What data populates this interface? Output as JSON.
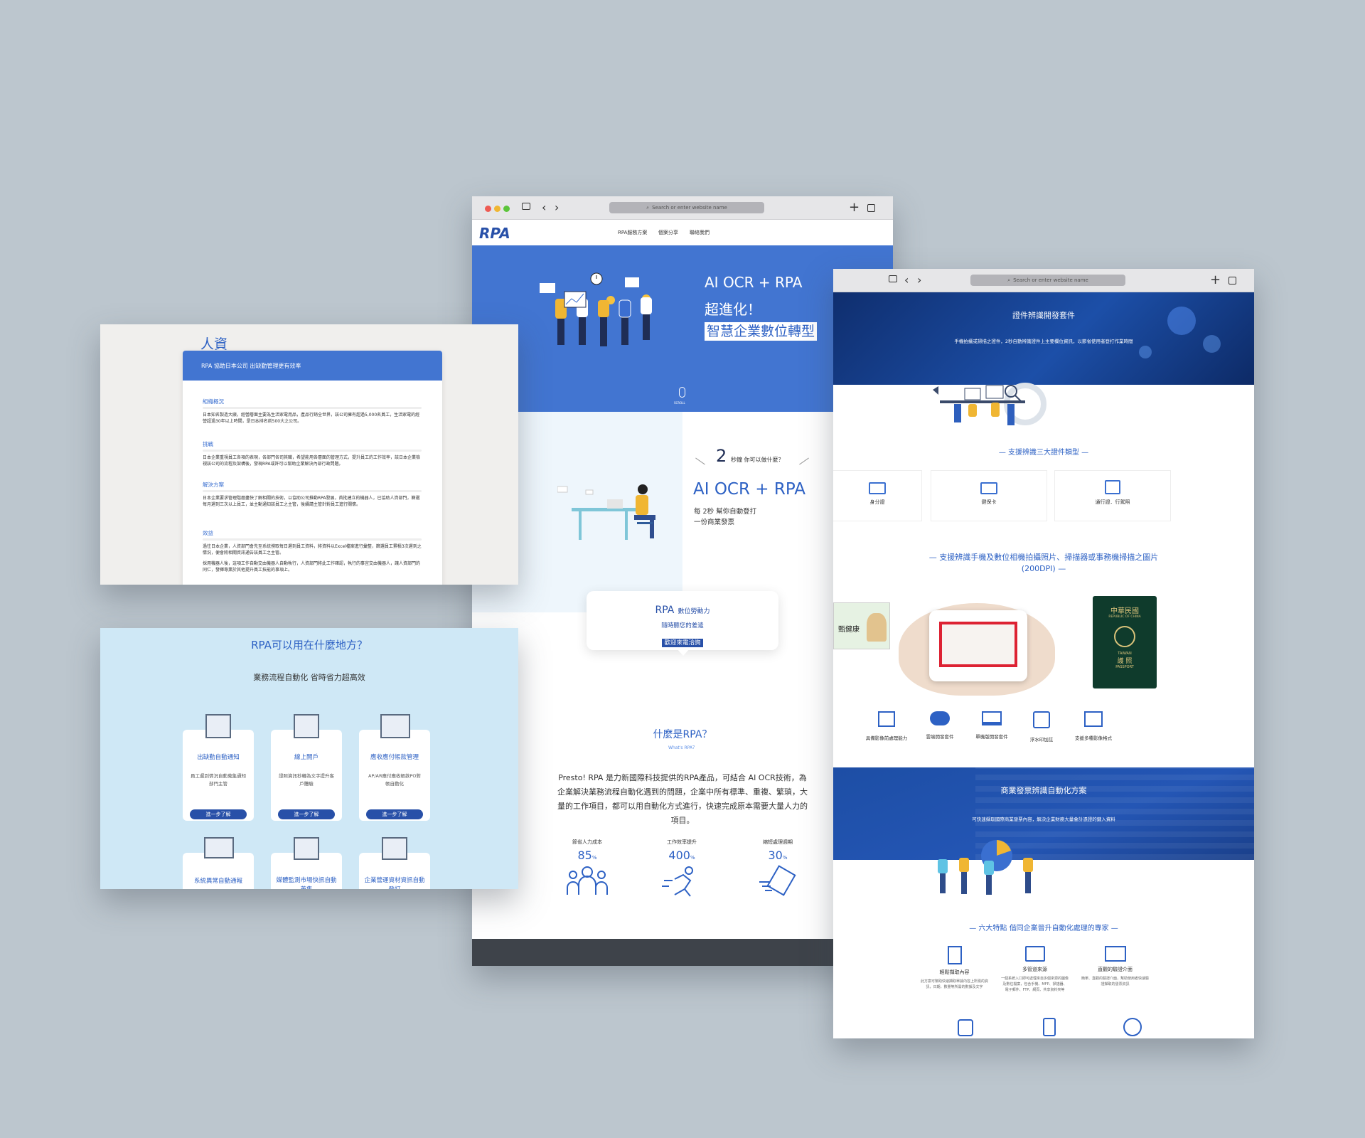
{
  "browser": {
    "url_placeholder": "Search or enter website name",
    "plus": "+",
    "back": "‹",
    "forward": "›"
  },
  "main_site": {
    "logo": "RPA",
    "nav": [
      "RPA服務方案",
      "個案分享",
      "聯絡我們"
    ],
    "hero": {
      "line1": "AI OCR + RPA",
      "line2": "超進化！",
      "line3": "智慧企業數位轉型",
      "scroll": "SCROLL"
    },
    "section2": {
      "num": "2",
      "q": "秒鐘 你可以做什麼？",
      "title": "AI OCR + RPA",
      "sub1": "每 2秒 幫你自動登打",
      "sub2": "一份商業發票"
    },
    "bubble": {
      "l1": "RPA",
      "l1b": "數位勞動力",
      "l2": "隨時聽您的差遣",
      "l3": "歡迎來電洽詢"
    },
    "what": {
      "title": "什麼是RPA？",
      "sub": "What's RPA？",
      "body": "Presto! RPA 是力新國際科技提供的RPA產品，可結合 AI OCR技術，為企業解決業務流程自動化遇到的問題，企業中所有標準、重複、繁瑣，大量的工作項目，都可以用自動化方式進行，快速完成原本需要大量人力的項目。"
    },
    "stats": [
      {
        "label": "節省人力成本",
        "value": "85",
        "unit": "%"
      },
      {
        "label": "工作效率提升",
        "value": "400",
        "unit": "%"
      },
      {
        "label": "縮短處理週期",
        "value": "30",
        "unit": "%"
      }
    ]
  },
  "hr_card": {
    "heading": "人資",
    "title": "RPA 協助日本公司 出缺勤管理更有效率",
    "sections": [
      {
        "h": "組織概況",
        "t": "日本知名製造大廠，經營層面主要為生活家電用品，產品行銷全世界，該公司擁有超過5,000名員工，生活家電的經營超過30年以上時間，是日本排名前500大之公司。"
      },
      {
        "h": "挑戰",
        "t": "日本企業重視員工各項的表現，各部門各司其職，希望能用各層面的管理方式，提升員工的工作效率，該日本企業檢視該公司的流程及架構後，發現RPA或許可以幫助企業解決內部行政問題。"
      },
      {
        "h": "解決方案",
        "t": "日本企業要求管理階層盡快了解相關的技術，以協助公司推動RPA發展，首批建立的機器人，已協助人資部門，篩選每月遲到三次以上員工，並主動通知該員工之主管，後續請主管針對員工進行關懷。"
      },
      {
        "h": "效益",
        "t": "過往日本企業，人資部門會先至系統撈取每日遲到員工資料，將資料以Excel檔案進行彙整，篩選員工累積3次遲到之情況，便會將相關資訊通告該員工之主管。"
      }
    ],
    "extra": "採用機器人後，這項工作自動交由機器人自動執行，人資部門將此工作確認，執行的事宜交由機器人，讓人資部門的同仁，發揮專業於其他提升員工技能的事項上。"
  },
  "usecase": {
    "title": "RPA可以用在什麼地方？",
    "sub": "業務流程自動化 省時省力超高效",
    "cards": [
      {
        "t": "出缺勤自動通知",
        "d": "員工遲到情況自動蒐集通知部門主管",
        "b": "進一步了解"
      },
      {
        "t": "線上開戶",
        "d": "證照資訊秒轉為文字提升客戶體驗",
        "b": "進一步了解"
      },
      {
        "t": "應收應付帳款管理",
        "d": "AP/AR應付應收帳款PO對帳自動化",
        "b": "進一步了解"
      }
    ],
    "cards2": [
      "系統異常自動通報",
      "媒體監測市場快訊自動蒐集",
      "企業營運資材資訊自動登打"
    ]
  },
  "right_site": {
    "hero_title": "證件辨識開發套件",
    "hero_sub": "手機拍攝或掃描之證件，2秒自動辨識證件上主要欄位資訊，以節省使用者登打作業時間",
    "sec1": "— 支援辨識三大證件類型 —",
    "ids": [
      "身分證",
      "健保卡",
      "通行證．行駕照"
    ],
    "sec2": "— 支援辨識手機及數位相機拍攝照片、掃描器或事務機掃描之圖片",
    "sec2b": "(200DPI) —",
    "card_name": "甄健康",
    "passport": {
      "t1": "中華民國",
      "t2": "REPUBLIC OF CHINA",
      "t3": "TAIWAN",
      "t4": "護 照",
      "t5": "PASSPORT"
    },
    "features": [
      "具備影像前處理能力",
      "雲端開發套件",
      "單機版開發套件",
      "浮水印加註",
      "支援多種影像格式"
    ],
    "band_title": "商業發票辨識自動化方案",
    "band_sub": "可快速擷取國際商業發票內容，解決企業財務大量會計憑證的鍵入資料",
    "six": "— 六大特點 偕同企業晉升自動化處理的專家 —",
    "points": [
      {
        "t": "輕鬆擷取內容",
        "d": "此方案可幫助快速擷取單據內容上所需的資訊，日期，數量等所需的數據及文字"
      },
      {
        "t": "多管道來源",
        "d": "一個系統入口即可處理來自多個來源的圖像及數位檔案，包含手機、MFP、掃描器、電子郵件、FTP、網頁、共享資料夾等"
      },
      {
        "t": "直觀的驗證介面",
        "d": "簡單、直觀的驗證介面，幫助使用者快速驗證擷取的發票資訊"
      }
    ]
  }
}
